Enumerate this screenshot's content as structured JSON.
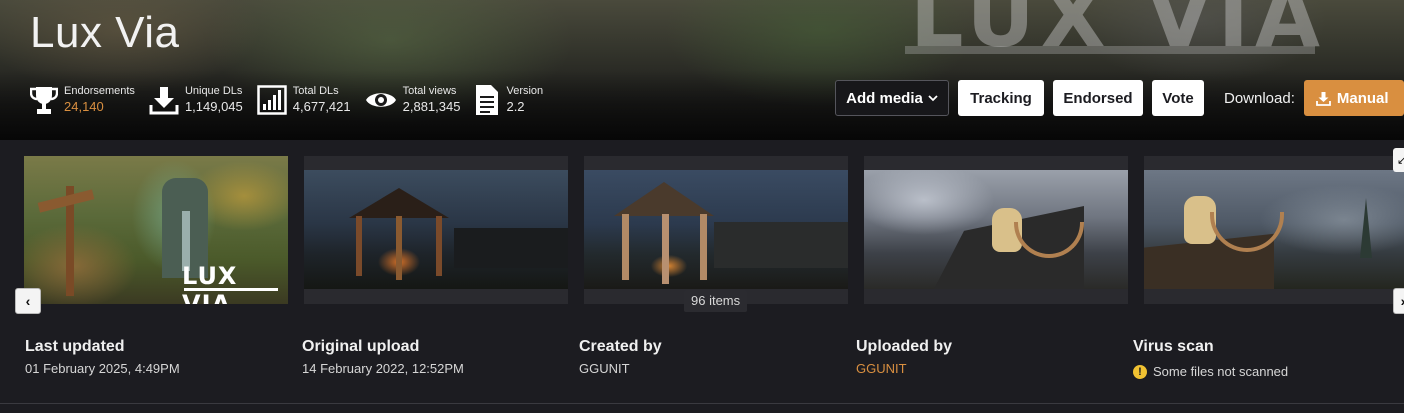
{
  "mod": {
    "title": "Lux Via",
    "banner_logo": "LUX VIA"
  },
  "stats": [
    {
      "icon": "trophy-icon",
      "label": "Endorsements",
      "value": "24,140",
      "highlight": true
    },
    {
      "icon": "download-icon",
      "label": "Unique DLs",
      "value": "1,149,045"
    },
    {
      "icon": "bar-chart-icon",
      "label": "Total DLs",
      "value": "4,677,421"
    },
    {
      "icon": "eye-icon",
      "label": "Total views",
      "value": "2,881,345"
    },
    {
      "icon": "document-icon",
      "label": "Version",
      "value": "2.2"
    }
  ],
  "actions": {
    "add_media": "Add media",
    "tracking": "Tracking",
    "endorsed": "Endorsed",
    "vote": "Vote",
    "download_label": "Download:",
    "manual": "Manual"
  },
  "gallery": {
    "item_count": "96 items",
    "images": [
      {
        "name": "lux-via-title-card",
        "logo": "LUX VIA"
      },
      {
        "name": "gazebo-night-1"
      },
      {
        "name": "gazebo-night-2"
      },
      {
        "name": "skull-shrine-mountain"
      },
      {
        "name": "skull-shrine-forest"
      }
    ]
  },
  "meta": {
    "last_updated": {
      "label": "Last updated",
      "value": "01 February 2025, 4:49PM"
    },
    "original_upload": {
      "label": "Original upload",
      "value": "14 February 2022, 12:52PM"
    },
    "created_by": {
      "label": "Created by",
      "value": "GGUNIT"
    },
    "uploaded_by": {
      "label": "Uploaded by",
      "value": "GGUNIT"
    },
    "virus_scan": {
      "label": "Virus scan",
      "value": "Some files not scanned"
    }
  },
  "colors": {
    "accent": "#d98f40",
    "background": "#1c1c21",
    "warning": "#f1c232"
  }
}
